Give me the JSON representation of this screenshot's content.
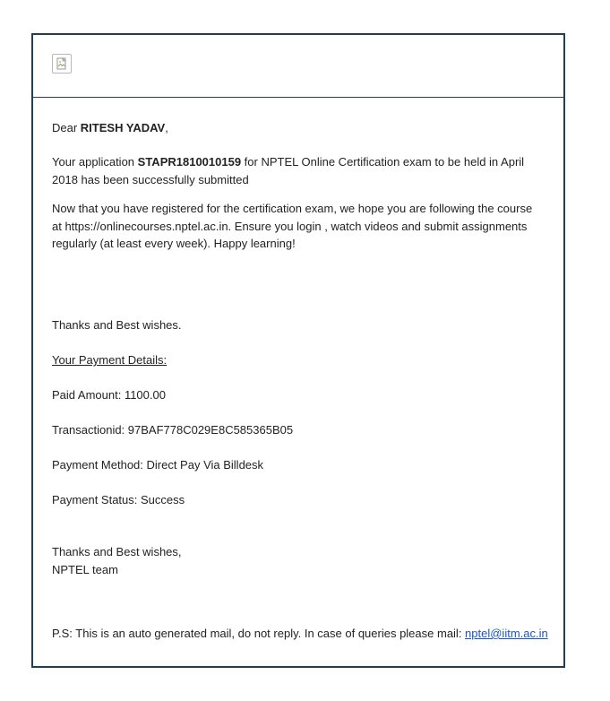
{
  "icons": {
    "logo": "broken-image-icon"
  },
  "colors": {
    "frame_border": "#1f3f55",
    "text": "#222222",
    "link": "#1a55c6"
  },
  "greeting": {
    "prefix": "Dear ",
    "name": "RITESH YADAV",
    "suffix": ","
  },
  "application": {
    "prefix": "Your application ",
    "id": "STAPR1810010159",
    "suffix": " for NPTEL Online Certification exam to be held in April 2018 has been successfully submitted"
  },
  "registration_note": "Now that you have registered for the certification exam, we hope you are following the course at https://onlinecourses.nptel.ac.in. Ensure you login , watch videos and submit assignments regularly (at least every week). Happy learning!",
  "thanks_line_1": "Thanks and Best wishes.",
  "payment": {
    "heading": "Your Payment Details:",
    "paid_amount": "Paid Amount: 1100.00",
    "transaction_id": "Transactionid: 97BAF778C029E8C585365B05",
    "method": "Payment Method: Direct Pay Via Billdesk",
    "status": "Payment Status: Success"
  },
  "signoff": {
    "line1": "Thanks and Best wishes,",
    "line2": "NPTEL team"
  },
  "ps": {
    "text": "P.S: This is an auto generated mail, do not reply. In case of queries please mail: ",
    "email": "nptel@iitm.ac.in"
  }
}
